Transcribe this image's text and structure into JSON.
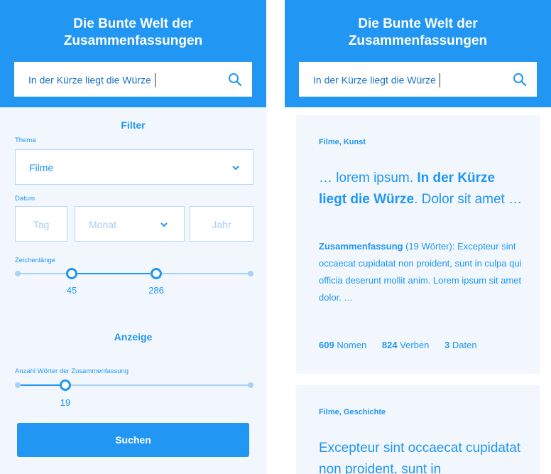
{
  "app_title_line1": "Die Bunte Welt der",
  "app_title_line2": "Zusammenfassungen",
  "search": {
    "value": "In der Kürze liegt die Würze"
  },
  "filter": {
    "title": "Filter",
    "topic_label": "Thema",
    "topic_value": "Filme",
    "date_label": "Datum",
    "day_placeholder": "Tag",
    "month_placeholder": "Monat",
    "year_placeholder": "Jahr",
    "length_label": "Zeichenlänge",
    "length_min": "45",
    "length_max": "286",
    "length_range_fraction": [
      0.24,
      0.59
    ]
  },
  "display": {
    "title": "Anzeige",
    "words_label": "Anzahl Wörter der Zusammenfassung",
    "words_value": "19",
    "words_fraction": 0.21
  },
  "search_button": "Suchen",
  "results": [
    {
      "tags": "Filme, Kunst",
      "title_pre": "… lorem ipsum. ",
      "title_bold": "In der Kürze liegt die Würze",
      "title_post": ". Dolor sit amet …",
      "summary_label": "Zusammenfassung",
      "summary_count": " (19 Wörter): ",
      "summary_text": "Excepteur sint occaecat cupidatat non proident, sunt in culpa qui officia deserunt mollit anim. Lorem ipsum sit amet dolor. …",
      "nouns_count": "609",
      "nouns_label": " Nomen",
      "verbs_count": "824",
      "verbs_label": " Verben",
      "dates_count": "3",
      "dates_label": " Daten"
    },
    {
      "tags": "Filme, Geschichte",
      "title_pre": "Excepteur sint occaecat cupidatat non proident, sunt in"
    }
  ],
  "colors": {
    "primary": "#2196f3",
    "panel_bg": "#f1f7fd",
    "track": "#a9d2f7"
  }
}
